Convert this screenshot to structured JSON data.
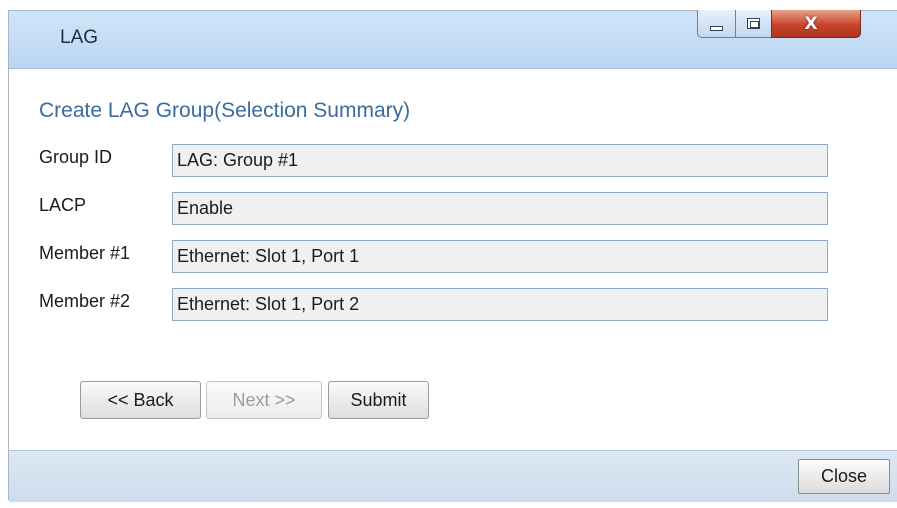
{
  "window": {
    "title": "LAG",
    "close_glyph": "X"
  },
  "form": {
    "heading": "Create LAG Group(Selection Summary)",
    "rows": [
      {
        "label": "Group ID",
        "value": "LAG: Group #1"
      },
      {
        "label": "LACP",
        "value": "Enable"
      },
      {
        "label": "Member #1",
        "value": "Ethernet: Slot 1, Port 1"
      },
      {
        "label": "Member #2",
        "value": "Ethernet: Slot 1, Port 2"
      }
    ]
  },
  "buttons": {
    "back": "<< Back",
    "next": "Next >>",
    "submit": "Submit"
  },
  "footer": {
    "close": "Close"
  },
  "icons": {
    "minimize": "minimize-icon",
    "maximize": "maximize-icon",
    "close": "close-icon"
  }
}
